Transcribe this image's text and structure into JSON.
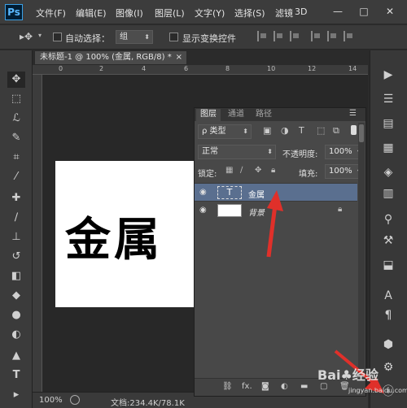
{
  "app": {
    "logo": "Ps"
  },
  "menu": [
    "文件(F)",
    "编辑(E)",
    "图像(I)",
    "图层(L)",
    "文字(Y)",
    "选择(S)",
    "滤镜",
    "3D"
  ],
  "window_buttons": [
    "—",
    "□",
    "✕"
  ],
  "options": {
    "auto_select_label": "自动选择：",
    "auto_select_value": "组",
    "show_transform_label": "显示变换控件"
  },
  "document": {
    "tab_title": "未标题-1 @ 100% (金属, RGB/8) *",
    "tab_close": "×",
    "canvas_text": "金属"
  },
  "ruler_numbers": [
    "0",
    "2",
    "4",
    "6",
    "8",
    "10",
    "12",
    "14"
  ],
  "status": {
    "zoom": "100%",
    "doc_info": "文档:234.4K/78.1K"
  },
  "layers_panel": {
    "tabs": [
      "图层",
      "通道",
      "路径"
    ],
    "filter_label": "ρ 类型",
    "blend_mode": "正常",
    "opacity_label": "不透明度:",
    "opacity_value": "100%",
    "lock_label": "锁定:",
    "fill_label": "填充:",
    "fill_value": "100%",
    "layers": [
      {
        "name": "金属",
        "type": "text",
        "thumb_glyph": "T",
        "selected": true
      },
      {
        "name": "背景",
        "type": "background",
        "locked": true,
        "selected": false
      }
    ],
    "footer_icons": [
      "link-icon",
      "fx-icon",
      "mask-icon",
      "adjustment-icon",
      "folder-icon",
      "new-layer-icon",
      "trash-icon"
    ],
    "footer_fx": "fx."
  },
  "watermark": {
    "text": "Bai♣经验",
    "sub": "jingyan.baidu.com"
  },
  "colors": {
    "accent_selected": "#5a6f8f",
    "arrow": "#e0302a"
  }
}
